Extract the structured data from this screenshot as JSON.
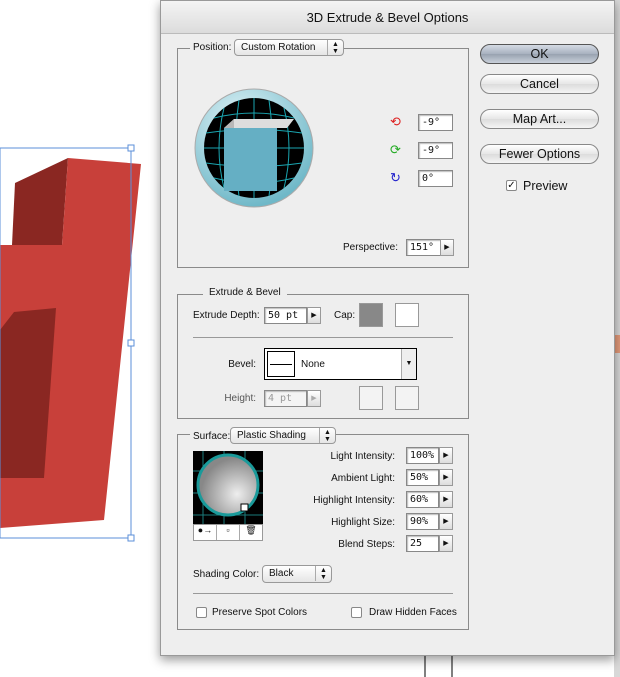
{
  "dialog": {
    "title": "3D Extrude & Bevel Options"
  },
  "position": {
    "label": "Position:",
    "preset": "Custom Rotation",
    "rotation_x": "-9°",
    "rotation_y": "-9°",
    "rotation_z": "0°",
    "perspective_label": "Perspective:",
    "perspective": "151°"
  },
  "extrude": {
    "legend": "Extrude & Bevel",
    "depth_label": "Extrude Depth:",
    "depth": "50 pt",
    "cap_label": "Cap:",
    "bevel_label": "Bevel:",
    "bevel": "None",
    "height_label": "Height:",
    "height": "4 pt"
  },
  "surface": {
    "label": "Surface:",
    "type": "Plastic Shading",
    "light_intensity_label": "Light Intensity:",
    "light_intensity": "100%",
    "ambient_light_label": "Ambient Light:",
    "ambient_light": "50%",
    "highlight_intensity_label": "Highlight Intensity:",
    "highlight_intensity": "60%",
    "highlight_size_label": "Highlight Size:",
    "highlight_size": "90%",
    "blend_steps_label": "Blend Steps:",
    "blend_steps": "25",
    "shading_color_label": "Shading Color:",
    "shading_color": "Black",
    "preserve_spot_label": "Preserve Spot Colors",
    "draw_hidden_label": "Draw Hidden Faces"
  },
  "buttons": {
    "ok": "OK",
    "cancel": "Cancel",
    "map_art": "Map Art...",
    "fewer_options": "Fewer Options",
    "preview": "Preview"
  },
  "colors": {
    "object_front": "#c8403a",
    "object_side": "#8a2722",
    "cube_face": "#65afc4",
    "selection": "#5b8fd9"
  }
}
